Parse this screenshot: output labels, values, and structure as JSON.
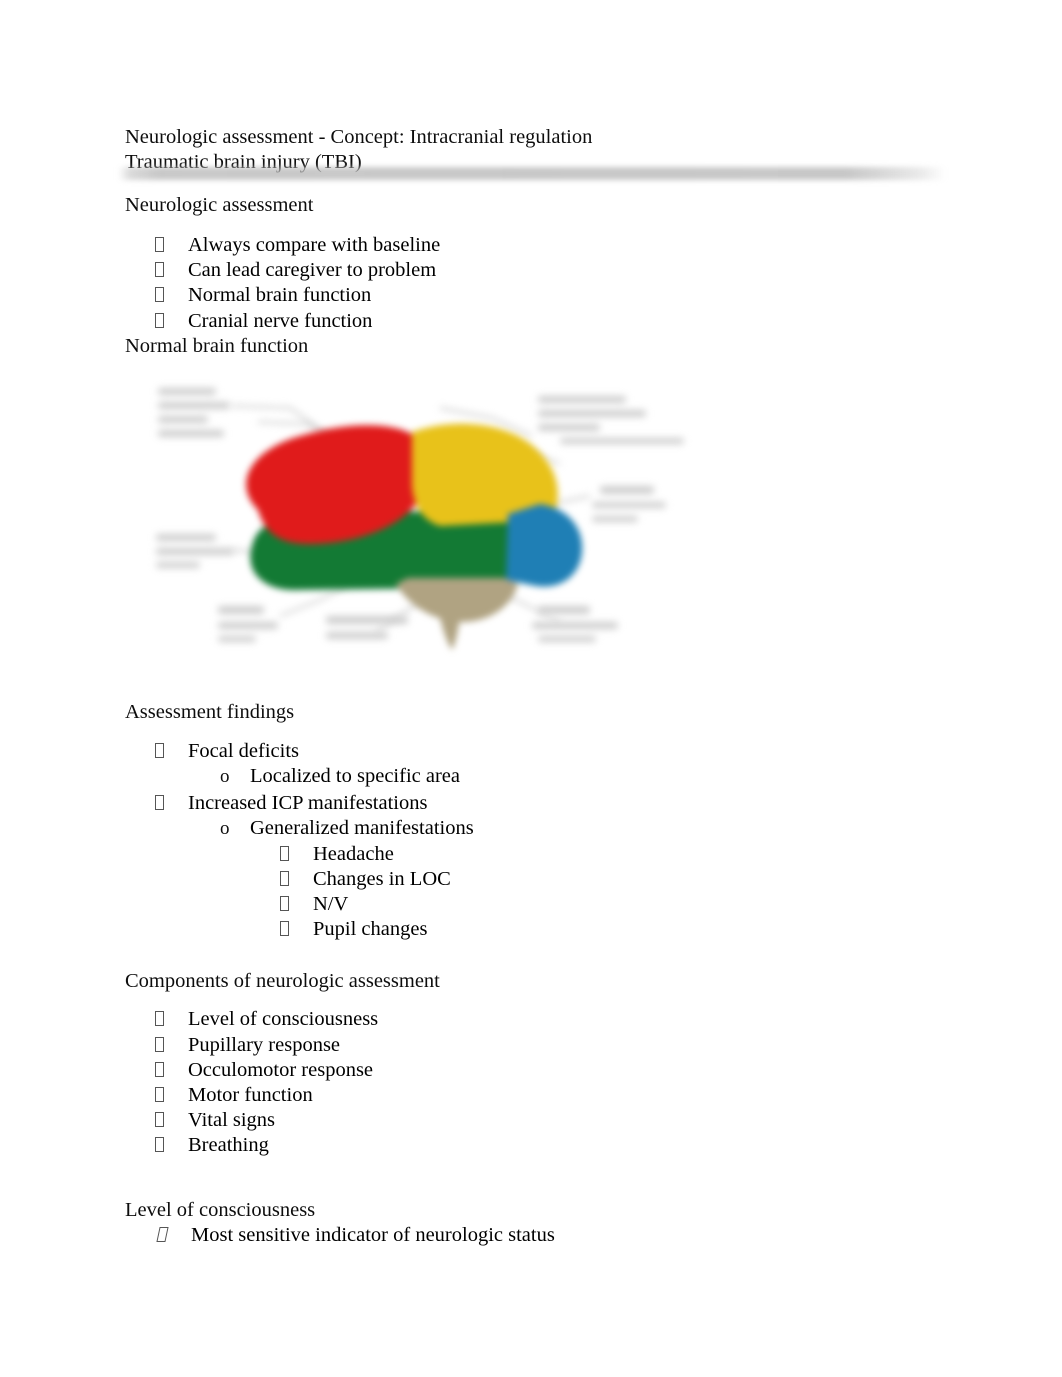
{
  "document": {
    "title_lines": [
      "Neurologic assessment - Concept: Intracranial regulation",
      "Traumatic brain injury (TBI)"
    ],
    "headings": {
      "neurologic_assessment": "Neurologic assessment",
      "normal_brain_function": "Normal brain function",
      "assessment_findings": "Assessment findings",
      "components": "Components of neurologic assessment",
      "level_of_consciousness": "Level of consciousness"
    },
    "neurologic_assessment_items": [
      "Always compare with baseline",
      "Can lead caregiver to problem",
      "Normal brain function",
      "Cranial nerve function"
    ],
    "assessment_findings_items": [
      {
        "level": 1,
        "marker": "tofu",
        "text": "Focal deficits"
      },
      {
        "level": 2,
        "marker": "circle",
        "text": "Localized to specific area"
      },
      {
        "level": 1,
        "marker": "tofu",
        "text": "Increased ICP manifestations"
      },
      {
        "level": 2,
        "marker": "circle",
        "text": "Generalized manifestations"
      },
      {
        "level": 3,
        "marker": "tofu",
        "text": "Headache"
      },
      {
        "level": 3,
        "marker": "tofu",
        "text": "Changes in LOC"
      },
      {
        "level": 3,
        "marker": "tofu",
        "text": "N/V"
      },
      {
        "level": 3,
        "marker": "tofu",
        "text": "Pupil changes"
      }
    ],
    "components_items": [
      "Level of consciousness",
      "Pupillary response",
      "Occulomotor response",
      "Motor function",
      "Vital signs",
      "Breathing"
    ],
    "level_of_consciousness_items": [
      "Most sensitive indicator of neurologic status"
    ],
    "circle_marker_glyph": "o"
  },
  "diagram": {
    "name": "brain-lobes-diagram",
    "description": "Blurred lateral view of the human brain with colored lobes and illegible gray callout labels",
    "colors": {
      "frontal_lobe_red": "#e01b1b",
      "parietal_lobe_yellow": "#e8c21a",
      "temporal_lobe_green": "#137a34",
      "occipital_lobe_blue": "#1f7fb5",
      "cerebellum_tan": "#b0a382",
      "label_gray": "#cfcfcf",
      "leader_line_gray": "#bdbdbd"
    }
  }
}
